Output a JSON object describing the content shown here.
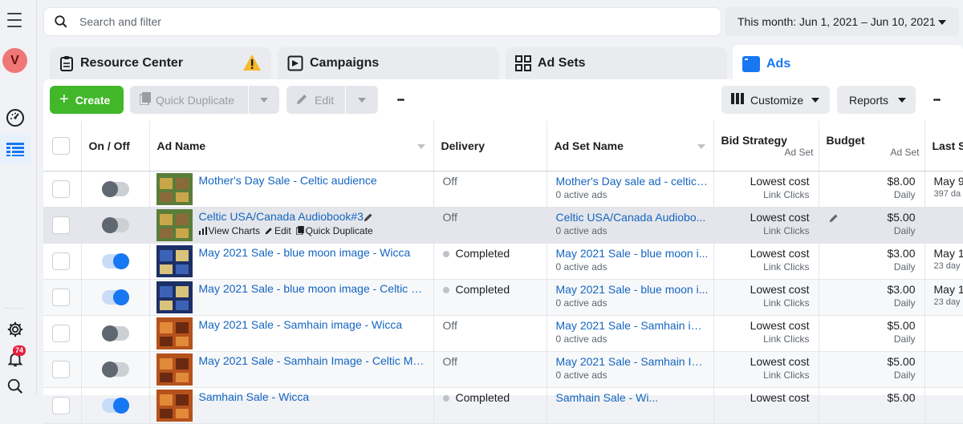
{
  "search": {
    "placeholder": "Search and filter"
  },
  "date_range": {
    "label": "This month: Jun 1, 2021 – Jun 10, 2021"
  },
  "avatar": {
    "initial": "V"
  },
  "notifications": {
    "count": "74"
  },
  "tabs": [
    {
      "label": "Resource Center"
    },
    {
      "label": "Campaigns"
    },
    {
      "label": "Ad Sets"
    },
    {
      "label": "Ads"
    }
  ],
  "toolbar": {
    "create": "Create",
    "quick_duplicate": "Quick Duplicate",
    "edit": "Edit",
    "more": "•••",
    "customize": "Customize",
    "reports": "Reports"
  },
  "columns": {
    "on_off": "On / Off",
    "ad_name": "Ad Name",
    "delivery": "Delivery",
    "ad_set_name": "Ad Set Name",
    "bid_strategy": "Bid Strategy",
    "bid_strategy_sub": "Ad Set",
    "budget": "Budget",
    "budget_sub": "Ad Set",
    "last": "Last S"
  },
  "row_actions": {
    "view_charts": "View Charts",
    "edit": "Edit",
    "quick_duplicate": "Quick Duplicate"
  },
  "rows": [
    {
      "ad_name": "Mother's Day Sale - Celtic audience",
      "toggle_on": false,
      "delivery": "Off",
      "delivery_dot": false,
      "ad_set": "Mother's Day sale ad - celtic ...",
      "ad_set_sub": "0 active ads",
      "bid": "Lowest cost",
      "bid_sub": "Link Clicks",
      "budget": "$8.00",
      "budget_sub": "Daily",
      "last": "May 9",
      "last_sub": "397 da",
      "thumb": "green"
    },
    {
      "ad_name": "Celtic USA/Canada Audiobook#3",
      "toggle_on": false,
      "delivery": "Off",
      "delivery_dot": false,
      "ad_set": "Celtic USA/Canada Audiobo...",
      "ad_set_sub": "0 active ads",
      "bid": "Lowest cost",
      "bid_sub": "Link Clicks",
      "budget": "$5.00",
      "budget_sub": "Daily",
      "last": "",
      "last_sub": "",
      "thumb": "green"
    },
    {
      "ad_name": "May 2021 Sale - blue moon image - Wicca",
      "toggle_on": true,
      "delivery": "Completed",
      "delivery_dot": true,
      "ad_set": "May 2021 Sale - blue moon i...",
      "ad_set_sub": "0 active ads",
      "bid": "Lowest cost",
      "bid_sub": "Link Clicks",
      "budget": "$3.00",
      "budget_sub": "Daily",
      "last": "May 1",
      "last_sub": "23 day",
      "thumb": "blue"
    },
    {
      "ad_name": "May 2021 Sale - blue moon image - Celtic M...",
      "toggle_on": true,
      "delivery": "Completed",
      "delivery_dot": true,
      "ad_set": "May 2021 Sale - blue moon i...",
      "ad_set_sub": "0 active ads",
      "bid": "Lowest cost",
      "bid_sub": "Link Clicks",
      "budget": "$3.00",
      "budget_sub": "Daily",
      "last": "May 1",
      "last_sub": "23 day",
      "thumb": "blue"
    },
    {
      "ad_name": "May 2021 Sale - Samhain image - Wicca",
      "toggle_on": false,
      "delivery": "Off",
      "delivery_dot": false,
      "ad_set": "May 2021 Sale - Samhain im...",
      "ad_set_sub": "0 active ads",
      "bid": "Lowest cost",
      "bid_sub": "Link Clicks",
      "budget": "$5.00",
      "budget_sub": "Daily",
      "last": "",
      "last_sub": "",
      "thumb": "orange"
    },
    {
      "ad_name": "May 2021 Sale - Samhain Image - Celtic Myt...",
      "toggle_on": false,
      "delivery": "Off",
      "delivery_dot": false,
      "ad_set": "May 2021 Sale - Samhain Im...",
      "ad_set_sub": "0 active ads",
      "bid": "Lowest cost",
      "bid_sub": "Link Clicks",
      "budget": "$5.00",
      "budget_sub": "Daily",
      "last": "",
      "last_sub": "",
      "thumb": "orange"
    },
    {
      "ad_name": "Samhain Sale - Wicca",
      "toggle_on": true,
      "delivery": "Completed",
      "delivery_dot": true,
      "ad_set": "Samhain Sale - Wi...",
      "ad_set_sub": "",
      "bid": "Lowest cost",
      "bid_sub": "",
      "budget": "$5.00",
      "budget_sub": "",
      "last": "",
      "last_sub": "",
      "thumb": "orange"
    }
  ],
  "colors": {
    "accent": "#1877f2",
    "create": "#42b72a",
    "warning": "#f7b928",
    "link": "#1565c0"
  }
}
